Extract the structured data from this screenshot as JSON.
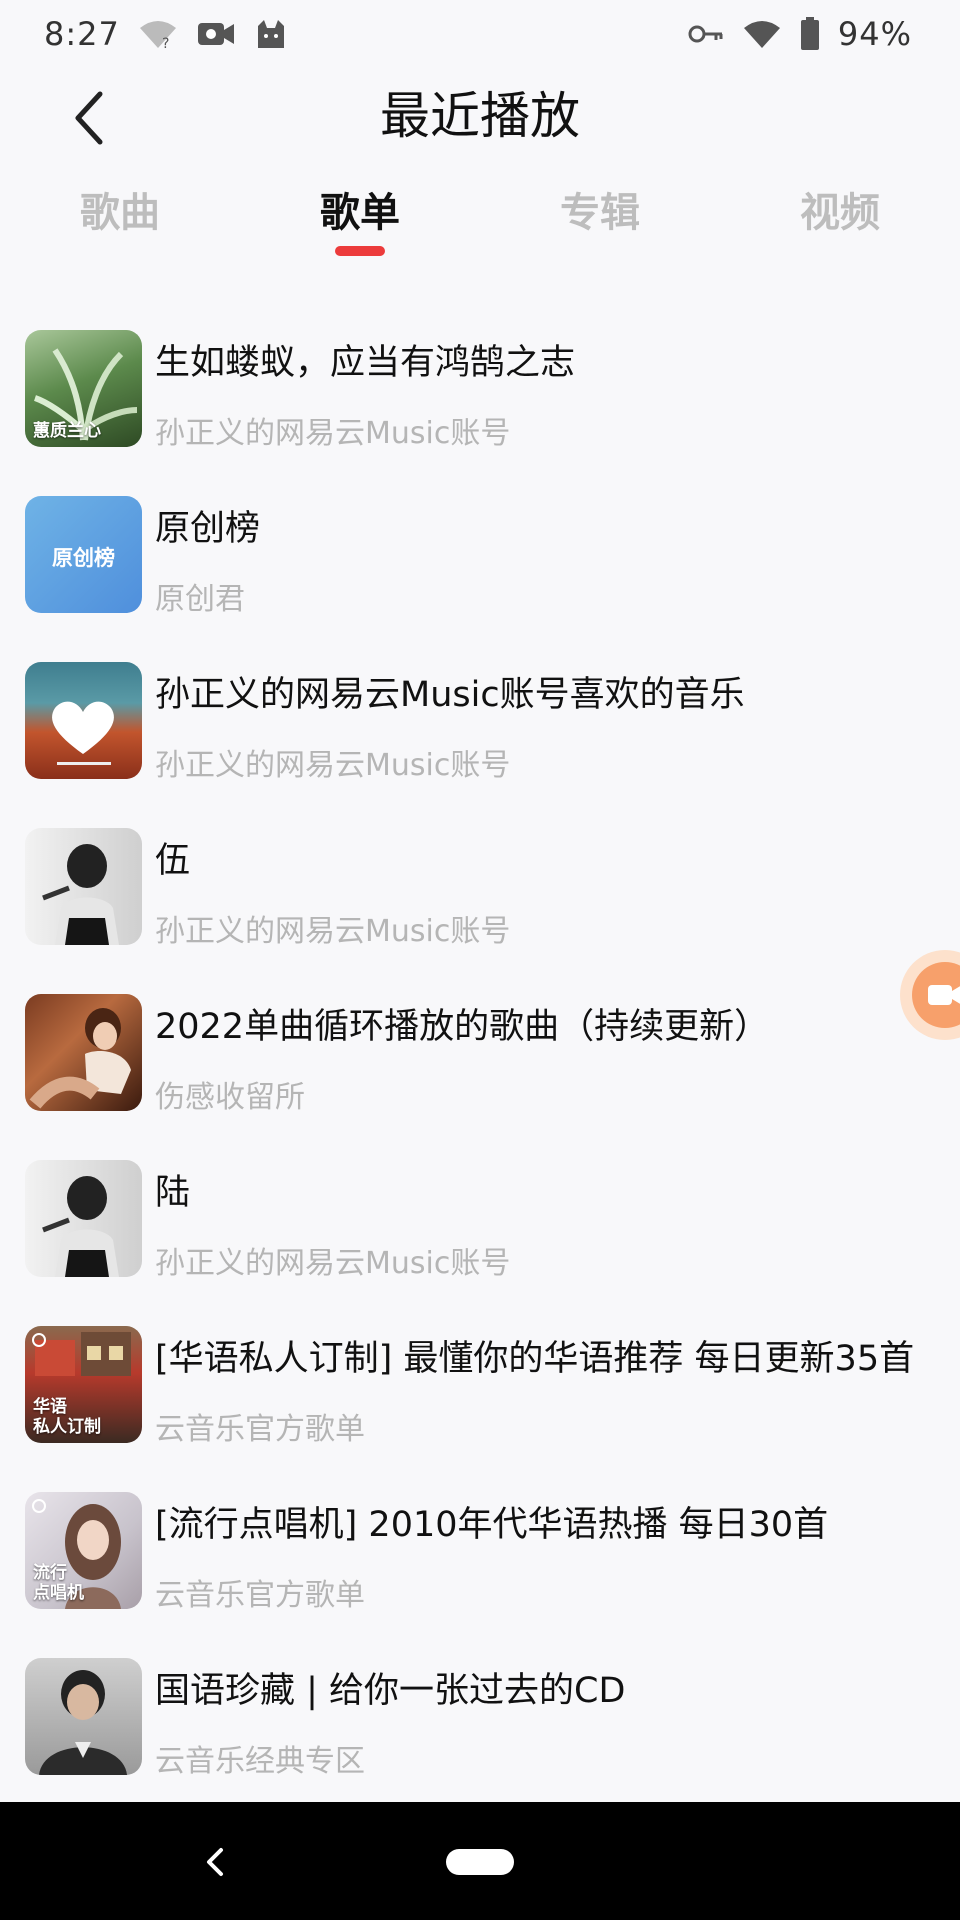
{
  "status_bar": {
    "time": "8:27",
    "battery": "94%",
    "icons": [
      "wifi-question-icon",
      "video-camera-icon",
      "cat-icon",
      "vpn-key-icon",
      "wifi-icon",
      "battery-icon"
    ]
  },
  "header": {
    "back_icon": "chevron-left-icon",
    "title": "最近播放"
  },
  "tabs": [
    {
      "label": "歌曲",
      "active": false
    },
    {
      "label": "歌单",
      "active": true
    },
    {
      "label": "专辑",
      "active": false
    },
    {
      "label": "视频",
      "active": false
    }
  ],
  "accent_color": "#ec3b3b",
  "playlists": [
    {
      "title": "生如蝼蚁，应当有鸿鹄之志",
      "subtitle": "孙正义的网易云Music账号",
      "cover_text": "蕙质兰心"
    },
    {
      "title": "原创榜",
      "subtitle": "原创君",
      "cover_text": "原创榜"
    },
    {
      "title": "孙正义的网易云Music账号喜欢的音乐",
      "subtitle": "孙正义的网易云Music账号",
      "cover_text": ""
    },
    {
      "title": "伍",
      "subtitle": "孙正义的网易云Music账号",
      "cover_text": ""
    },
    {
      "title": "2022单曲循环播放的歌曲（持续更新）",
      "subtitle": "伤感收留所",
      "cover_text": ""
    },
    {
      "title": "陆",
      "subtitle": "孙正义的网易云Music账号",
      "cover_text": ""
    },
    {
      "title": "[华语私人订制] 最懂你的华语推荐 每日更新35首",
      "subtitle": "云音乐官方歌单",
      "cover_text_line1": "华语",
      "cover_text_line2": "私人订制"
    },
    {
      "title": "[流行点唱机] 2010年代华语热播 每日30首",
      "subtitle": "云音乐官方歌单",
      "cover_text_line1": "流行",
      "cover_text_line2": "点唱机"
    },
    {
      "title": "国语珍藏 | 给你一张过去的CD",
      "subtitle": "云音乐经典专区",
      "cover_text": ""
    }
  ],
  "floating_button": {
    "icon": "video-camera-icon"
  },
  "nav_bar": {
    "back_icon": "nav-back-icon",
    "home_icon": "home-pill-icon"
  }
}
